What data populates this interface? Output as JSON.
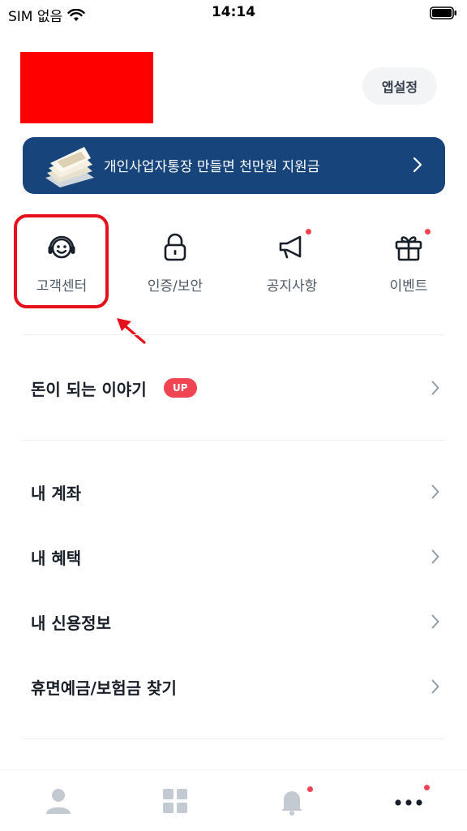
{
  "status_bar": {
    "carrier": "SIM 없음",
    "time": "14:14"
  },
  "header": {
    "settings_label": "앱설정"
  },
  "banner": {
    "text": "개인사업자통장 만들면 천만원 지원금"
  },
  "quick_menu": [
    {
      "label": "고객센터",
      "icon": "headset-smile-icon",
      "has_dot": false,
      "highlighted": true
    },
    {
      "label": "인증/보안",
      "icon": "lock-icon",
      "has_dot": false
    },
    {
      "label": "공지사항",
      "icon": "megaphone-icon",
      "has_dot": true
    },
    {
      "label": "이벤트",
      "icon": "gift-icon",
      "has_dot": true
    }
  ],
  "featured": {
    "label": "돈이 되는 이야기",
    "badge": "UP"
  },
  "menu_items": [
    {
      "label": "내 계좌"
    },
    {
      "label": "내 혜택"
    },
    {
      "label": "내 신용정보"
    },
    {
      "label": "휴면예금/보험금 찾기"
    }
  ],
  "tab_bar": [
    {
      "icon": "person-icon",
      "has_dot": false
    },
    {
      "icon": "grid-icon",
      "has_dot": false
    },
    {
      "icon": "bell-icon",
      "has_dot": true
    },
    {
      "icon": "more-icon",
      "has_dot": true,
      "active": true
    }
  ],
  "colors": {
    "banner_bg": "#17447a",
    "accent_red": "#f04452",
    "annotation_red": "#e5101b"
  }
}
